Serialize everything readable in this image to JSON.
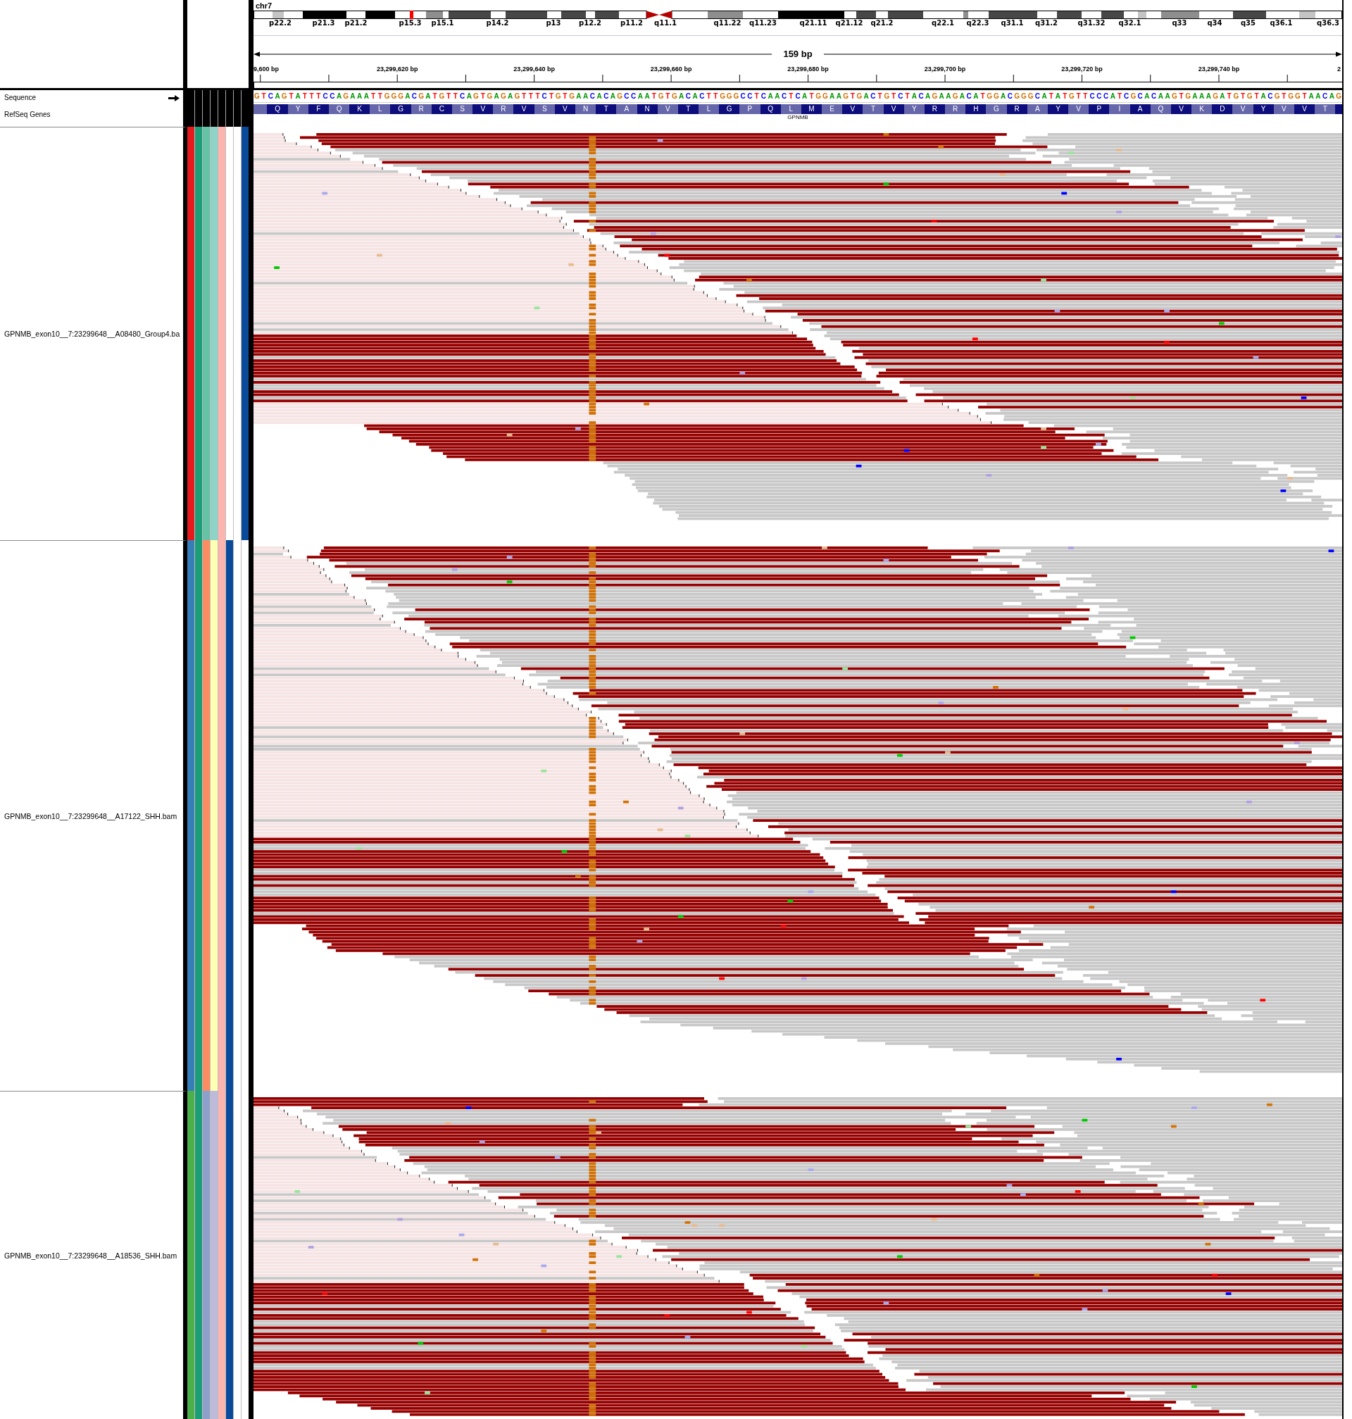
{
  "ideogram": {
    "chromosome": "chr7",
    "band_labels": [
      "p22.2",
      "p21.3",
      "p21.2",
      "p15.3",
      "p15.1",
      "p14.2",
      "p13",
      "p12.2",
      "p11.2",
      "q11.1",
      "q11.22",
      "q11.23",
      "q21.11",
      "q21.12",
      "q21.2",
      "q22.1",
      "q22.3",
      "q31.1",
      "q31.2",
      "q31.32",
      "q32.1",
      "q33",
      "q34",
      "q35",
      "q36.1",
      "q36.3"
    ]
  },
  "ruler": {
    "span": "159 bp",
    "tick_labels": [
      "9,600 bp",
      "23,299,620 bp",
      "23,299,640 bp",
      "23,299,660 bp",
      "23,299,680 bp",
      "23,299,700 bp",
      "23,299,720 bp",
      "23,299,740 bp",
      "2"
    ]
  },
  "sequence_track": {
    "name": "Sequence",
    "bases": [
      {
        "base": "G",
        "color": "#d17105"
      },
      {
        "base": "T",
        "color": "#ff0000"
      },
      {
        "base": "C",
        "color": "#0000ff"
      },
      {
        "base": "A",
        "color": "#009600"
      },
      {
        "base": "G",
        "color": "#d17105"
      },
      {
        "base": "T",
        "color": "#ff0000"
      },
      {
        "base": "A",
        "color": "#009600"
      },
      {
        "base": "T",
        "color": "#ff0000"
      },
      {
        "base": "T",
        "color": "#ff0000"
      },
      {
        "base": "T",
        "color": "#ff0000"
      },
      {
        "base": "C",
        "color": "#0000ff"
      },
      {
        "base": "C",
        "color": "#0000ff"
      },
      {
        "base": "A",
        "color": "#009600"
      },
      {
        "base": "G",
        "color": "#d17105"
      },
      {
        "base": "A",
        "color": "#009600"
      },
      {
        "base": "A",
        "color": "#009600"
      },
      {
        "base": "A",
        "color": "#009600"
      },
      {
        "base": "T",
        "color": "#ff0000"
      },
      {
        "base": "T",
        "color": "#ff0000"
      },
      {
        "base": "G",
        "color": "#d17105"
      },
      {
        "base": "G",
        "color": "#d17105"
      },
      {
        "base": "G",
        "color": "#d17105"
      },
      {
        "base": "A",
        "color": "#009600"
      },
      {
        "base": "C",
        "color": "#0000ff"
      },
      {
        "base": "G",
        "color": "#d17105"
      },
      {
        "base": "A",
        "color": "#009600"
      },
      {
        "base": "T",
        "color": "#ff0000"
      },
      {
        "base": "G",
        "color": "#d17105"
      },
      {
        "base": "T",
        "color": "#ff0000"
      },
      {
        "base": "T",
        "color": "#ff0000"
      },
      {
        "base": "C",
        "color": "#0000ff"
      },
      {
        "base": "A",
        "color": "#009600"
      },
      {
        "base": "G",
        "color": "#d17105"
      },
      {
        "base": "T",
        "color": "#ff0000"
      },
      {
        "base": "G",
        "color": "#d17105"
      },
      {
        "base": "A",
        "color": "#009600"
      },
      {
        "base": "G",
        "color": "#d17105"
      },
      {
        "base": "A",
        "color": "#009600"
      },
      {
        "base": "G",
        "color": "#d17105"
      },
      {
        "base": "T",
        "color": "#ff0000"
      },
      {
        "base": "T",
        "color": "#ff0000"
      },
      {
        "base": "T",
        "color": "#ff0000"
      },
      {
        "base": "C",
        "color": "#0000ff"
      },
      {
        "base": "T",
        "color": "#ff0000"
      },
      {
        "base": "G",
        "color": "#d17105"
      },
      {
        "base": "T",
        "color": "#ff0000"
      },
      {
        "base": "G",
        "color": "#d17105"
      },
      {
        "base": "A",
        "color": "#009600"
      },
      {
        "base": "A",
        "color": "#009600"
      },
      {
        "base": "C",
        "color": "#0000ff"
      },
      {
        "base": "A",
        "color": "#009600"
      },
      {
        "base": "C",
        "color": "#0000ff"
      },
      {
        "base": "A",
        "color": "#009600"
      },
      {
        "base": "G",
        "color": "#d17105"
      },
      {
        "base": "C",
        "color": "#0000ff"
      },
      {
        "base": "C",
        "color": "#0000ff"
      },
      {
        "base": "A",
        "color": "#009600"
      },
      {
        "base": "A",
        "color": "#009600"
      },
      {
        "base": "T",
        "color": "#ff0000"
      },
      {
        "base": "G",
        "color": "#d17105"
      },
      {
        "base": "T",
        "color": "#ff0000"
      },
      {
        "base": "G",
        "color": "#d17105"
      },
      {
        "base": "A",
        "color": "#009600"
      },
      {
        "base": "C",
        "color": "#0000ff"
      },
      {
        "base": "A",
        "color": "#009600"
      },
      {
        "base": "C",
        "color": "#0000ff"
      },
      {
        "base": "T",
        "color": "#ff0000"
      },
      {
        "base": "T",
        "color": "#ff0000"
      },
      {
        "base": "G",
        "color": "#d17105"
      },
      {
        "base": "G",
        "color": "#d17105"
      },
      {
        "base": "G",
        "color": "#d17105"
      },
      {
        "base": "C",
        "color": "#0000ff"
      },
      {
        "base": "C",
        "color": "#0000ff"
      },
      {
        "base": "T",
        "color": "#ff0000"
      },
      {
        "base": "C",
        "color": "#0000ff"
      },
      {
        "base": "A",
        "color": "#009600"
      },
      {
        "base": "A",
        "color": "#009600"
      },
      {
        "base": "C",
        "color": "#0000ff"
      },
      {
        "base": "T",
        "color": "#ff0000"
      },
      {
        "base": "C",
        "color": "#0000ff"
      },
      {
        "base": "A",
        "color": "#009600"
      },
      {
        "base": "T",
        "color": "#ff0000"
      },
      {
        "base": "G",
        "color": "#d17105"
      },
      {
        "base": "G",
        "color": "#d17105"
      },
      {
        "base": "A",
        "color": "#009600"
      },
      {
        "base": "A",
        "color": "#009600"
      },
      {
        "base": "G",
        "color": "#d17105"
      },
      {
        "base": "T",
        "color": "#ff0000"
      },
      {
        "base": "G",
        "color": "#d17105"
      },
      {
        "base": "A",
        "color": "#009600"
      },
      {
        "base": "C",
        "color": "#0000ff"
      },
      {
        "base": "T",
        "color": "#ff0000"
      },
      {
        "base": "G",
        "color": "#d17105"
      },
      {
        "base": "T",
        "color": "#ff0000"
      },
      {
        "base": "C",
        "color": "#0000ff"
      },
      {
        "base": "T",
        "color": "#ff0000"
      },
      {
        "base": "A",
        "color": "#009600"
      },
      {
        "base": "C",
        "color": "#0000ff"
      },
      {
        "base": "A",
        "color": "#009600"
      },
      {
        "base": "G",
        "color": "#d17105"
      },
      {
        "base": "A",
        "color": "#009600"
      },
      {
        "base": "A",
        "color": "#009600"
      },
      {
        "base": "G",
        "color": "#d17105"
      },
      {
        "base": "A",
        "color": "#009600"
      },
      {
        "base": "C",
        "color": "#0000ff"
      },
      {
        "base": "A",
        "color": "#009600"
      },
      {
        "base": "T",
        "color": "#ff0000"
      },
      {
        "base": "G",
        "color": "#d17105"
      },
      {
        "base": "G",
        "color": "#d17105"
      },
      {
        "base": "A",
        "color": "#009600"
      },
      {
        "base": "C",
        "color": "#0000ff"
      },
      {
        "base": "G",
        "color": "#d17105"
      },
      {
        "base": "G",
        "color": "#d17105"
      },
      {
        "base": "G",
        "color": "#d17105"
      },
      {
        "base": "C",
        "color": "#0000ff"
      },
      {
        "base": "A",
        "color": "#009600"
      },
      {
        "base": "T",
        "color": "#ff0000"
      },
      {
        "base": "A",
        "color": "#009600"
      },
      {
        "base": "T",
        "color": "#ff0000"
      },
      {
        "base": "G",
        "color": "#d17105"
      },
      {
        "base": "T",
        "color": "#ff0000"
      },
      {
        "base": "T",
        "color": "#ff0000"
      },
      {
        "base": "C",
        "color": "#0000ff"
      },
      {
        "base": "C",
        "color": "#0000ff"
      },
      {
        "base": "C",
        "color": "#0000ff"
      },
      {
        "base": "A",
        "color": "#009600"
      },
      {
        "base": "T",
        "color": "#ff0000"
      },
      {
        "base": "C",
        "color": "#0000ff"
      },
      {
        "base": "G",
        "color": "#d17105"
      },
      {
        "base": "C",
        "color": "#0000ff"
      },
      {
        "base": "A",
        "color": "#009600"
      },
      {
        "base": "C",
        "color": "#0000ff"
      },
      {
        "base": "A",
        "color": "#009600"
      },
      {
        "base": "A",
        "color": "#009600"
      },
      {
        "base": "G",
        "color": "#d17105"
      },
      {
        "base": "T",
        "color": "#ff0000"
      },
      {
        "base": "G",
        "color": "#d17105"
      },
      {
        "base": "A",
        "color": "#009600"
      },
      {
        "base": "A",
        "color": "#009600"
      },
      {
        "base": "A",
        "color": "#009600"
      },
      {
        "base": "G",
        "color": "#d17105"
      },
      {
        "base": "A",
        "color": "#009600"
      },
      {
        "base": "T",
        "color": "#ff0000"
      },
      {
        "base": "G",
        "color": "#d17105"
      },
      {
        "base": "T",
        "color": "#ff0000"
      },
      {
        "base": "G",
        "color": "#d17105"
      },
      {
        "base": "T",
        "color": "#ff0000"
      },
      {
        "base": "A",
        "color": "#009600"
      },
      {
        "base": "C",
        "color": "#0000ff"
      },
      {
        "base": "G",
        "color": "#d17105"
      },
      {
        "base": "T",
        "color": "#ff0000"
      },
      {
        "base": "G",
        "color": "#d17105"
      },
      {
        "base": "G",
        "color": "#d17105"
      },
      {
        "base": "T",
        "color": "#ff0000"
      },
      {
        "base": "A",
        "color": "#009600"
      },
      {
        "base": "A",
        "color": "#009600"
      },
      {
        "base": "C",
        "color": "#0000ff"
      },
      {
        "base": "A",
        "color": "#009600"
      },
      {
        "base": "G",
        "color": "#d17105"
      }
    ]
  },
  "gene_track": {
    "name": "RefSeq Genes",
    "gene": "GPNMB",
    "amino_acids": [
      "Q",
      "Y",
      "F",
      "Q",
      "K",
      "L",
      "G",
      "R",
      "C",
      "S",
      "V",
      "R",
      "V",
      "S",
      "V",
      "N",
      "T",
      "A",
      "N",
      "V",
      "T",
      "L",
      "G",
      "P",
      "Q",
      "L",
      "M",
      "E",
      "V",
      "T",
      "V",
      "Y",
      "R",
      "R",
      "H",
      "G",
      "R",
      "A",
      "Y",
      "V",
      "P",
      "I",
      "A",
      "Q",
      "V",
      "K",
      "D",
      "V",
      "Y",
      "V",
      "V",
      "T"
    ]
  },
  "alignment_tracks": [
    {
      "name": "GPNMB_exon10__7:23299648__A08480_Group4.ba",
      "attributes": [
        {
          "color": "#e41a1c"
        },
        {
          "color": "#1b9e77"
        },
        {
          "color": "#66c2a5"
        },
        {
          "color": "#8dd3c7"
        },
        {
          "color": "#fbb4ae"
        },
        {
          "color": "#ffffff"
        },
        {
          "color": "#ffffff"
        },
        {
          "color": "#0a4a9a"
        }
      ]
    },
    {
      "name": "GPNMB_exon10__7:23299648__A17122_SHH.bam",
      "attributes": [
        {
          "color": "#377eb8"
        },
        {
          "color": "#1b9e77"
        },
        {
          "color": "#fc8d62"
        },
        {
          "color": "#ffffb3"
        },
        {
          "color": "#fbb4ae"
        },
        {
          "color": "#0a4a9a"
        },
        {
          "color": "#ffffff"
        },
        {
          "color": "#ffffff"
        }
      ]
    },
    {
      "name": "GPNMB_exon10__7:23299648__A18536_SHH.bam",
      "attributes": [
        {
          "color": "#4daf4a"
        },
        {
          "color": "#1b9e77"
        },
        {
          "color": "#8da0cb"
        },
        {
          "color": "#bebada"
        },
        {
          "color": "#fbb4ae"
        },
        {
          "color": "#0a4a9a"
        },
        {
          "color": "#ffffff"
        },
        {
          "color": "#ffffff"
        }
      ]
    }
  ]
}
